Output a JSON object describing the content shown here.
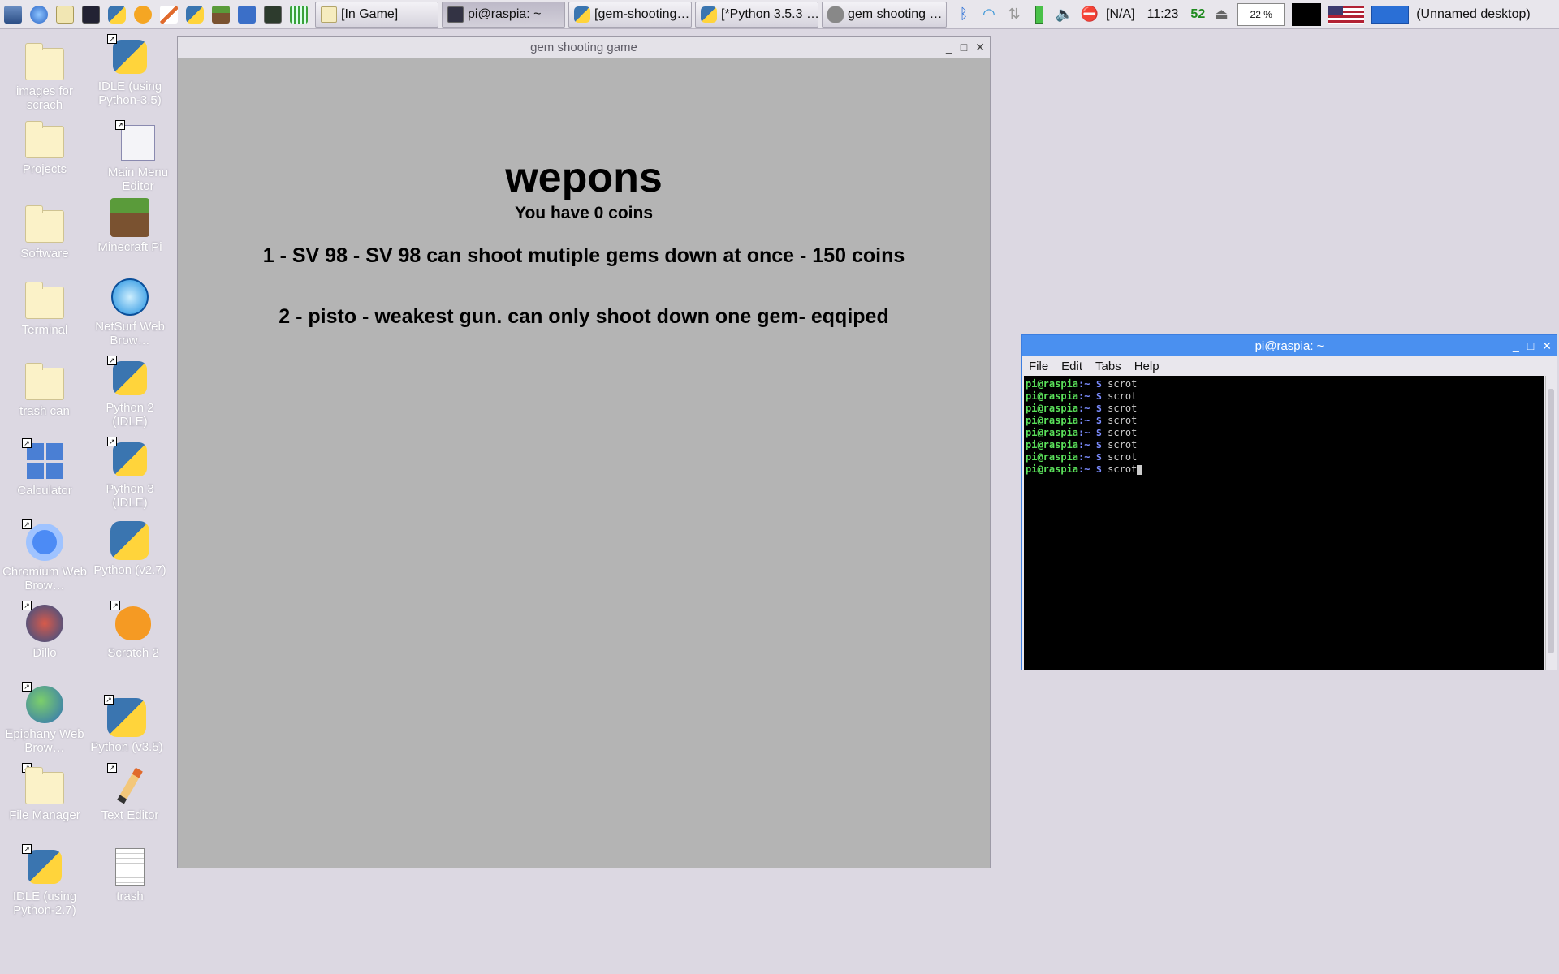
{
  "taskbar": {
    "tasks": [
      {
        "label": "[In Game]",
        "icon": "folder-icon"
      },
      {
        "label": "pi@raspia: ~",
        "icon": "terminal-icon"
      },
      {
        "label": "[gem-shooting…",
        "icon": "python-icon"
      },
      {
        "label": "[*Python 3.5.3 …",
        "icon": "python-icon"
      },
      {
        "label": "gem shooting …",
        "icon": "gamepad-icon"
      }
    ],
    "tray": {
      "volume_na": "[N/A]",
      "clock": "11:23",
      "cpu": "52",
      "cpu_percent": "22 %",
      "desktop": "(Unnamed desktop)"
    }
  },
  "desktop_icons": [
    {
      "label": "images for scrach",
      "icon": "folder-icon"
    },
    {
      "label": "IDLE (using Python-3.5)",
      "icon": "python-icon"
    },
    {
      "label": "Projects",
      "icon": "folder-icon"
    },
    {
      "label": "Main Menu Editor",
      "icon": "menu-editor-icon"
    },
    {
      "label": "Software",
      "icon": "folder-icon"
    },
    {
      "label": "Minecraft Pi",
      "icon": "minecraft-icon"
    },
    {
      "label": "Terminal",
      "icon": "folder-icon"
    },
    {
      "label": "NetSurf Web Brow…",
      "icon": "netsurf-icon"
    },
    {
      "label": "trash can",
      "icon": "folder-icon"
    },
    {
      "label": "Python 2 (IDLE)",
      "icon": "python-icon"
    },
    {
      "label": "Calculator",
      "icon": "calculator-icon"
    },
    {
      "label": "Python 3 (IDLE)",
      "icon": "python-icon"
    },
    {
      "label": "Chromium Web Brow…",
      "icon": "chromium-icon"
    },
    {
      "label": "Python (v2.7)",
      "icon": "python-icon"
    },
    {
      "label": "Dillo",
      "icon": "dillo-icon"
    },
    {
      "label": "Scratch 2",
      "icon": "scratch-icon"
    },
    {
      "label": "Epiphany Web Brow…",
      "icon": "epiphany-icon"
    },
    {
      "label": "Python (v3.5)",
      "icon": "python-icon"
    },
    {
      "label": "File Manager",
      "icon": "file-manager-icon"
    },
    {
      "label": "Text Editor",
      "icon": "text-editor-icon"
    },
    {
      "label": "IDLE (using Python-2.7)",
      "icon": "python-icon"
    },
    {
      "label": "trash",
      "icon": "document-icon"
    }
  ],
  "game": {
    "window_title": "gem shooting game",
    "heading": "wepons",
    "coins": "You have 0 coins",
    "items": [
      "1 - SV 98 - SV 98 can shoot mutiple gems down at once - 150 coins",
      "2 - pisto - weakest gun. can only shoot down one gem- eqqiped"
    ]
  },
  "terminal": {
    "window_title": "pi@raspia: ~",
    "menu": [
      "File",
      "Edit",
      "Tabs",
      "Help"
    ],
    "prompt_user": "pi@raspia",
    "prompt_dir": ":~ $",
    "lines": [
      "scrot",
      "scrot",
      "scrot",
      "scrot",
      "scrot",
      "scrot",
      "scrot",
      "scrot"
    ]
  }
}
